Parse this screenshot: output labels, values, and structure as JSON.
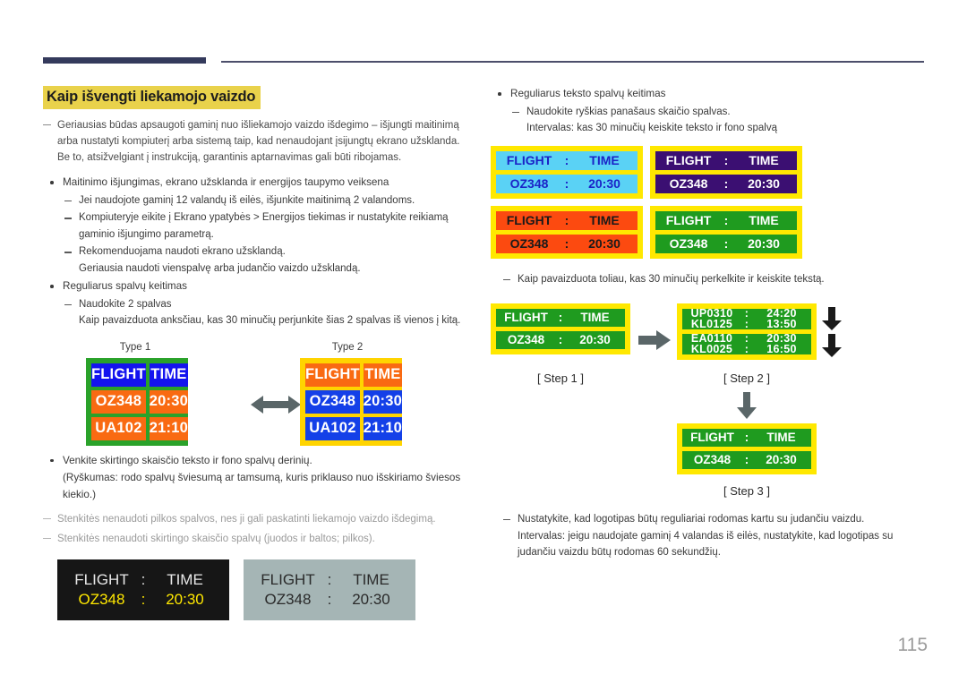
{
  "page": {
    "number": "115"
  },
  "left": {
    "title": "Kaip išvengti liekamojo vaizdo",
    "note_top": "Geriausias būdas apsaugoti gaminį nuo išliekamojo vaizdo išdegimo – išjungti maitinimą arba nustatyti kompiuterį arba sistemą taip, kad nenaudojant įsijungtų ekrano užsklanda. Be to, atsižvelgiant į instrukciją, garantinis aptarnavimas gali būti ribojamas.",
    "bullet1": "Maitinimo išjungimas, ekrano užsklanda ir energijos taupymo veiksena",
    "bullet1_items": [
      "Jei naudojote gaminį 12 valandų iš eilės, išjunkite maitinimą 2 valandoms.",
      "Kompiuteryje eikite į Ekrano ypatybės > Energijos tiekimas ir nustatykite reikiamą gaminio išjungimo parametrą.",
      "Rekomenduojama naudoti ekrano užsklandą."
    ],
    "bullet1_sub": "Geriausia naudoti vienspalvę arba judančio vaizdo užsklandą.",
    "bullet2": "Reguliarus spalvų keitimas",
    "bullet2_item": "Naudokite 2 spalvas",
    "bullet2_sub": "Kaip pavaizduota anksčiau, kas 30 minučių perjunkite šias 2 spalvas iš vienos į kitą.",
    "type1_label": "Type 1",
    "type2_label": "Type 2",
    "bullet3": "Venkite skirtingo skaisčio teksto ir fono spalvų derinių.",
    "bullet3_sub": "(Ryškumas: rodo spalvų šviesumą ar tamsumą, kuris priklauso nuo išskiriamo šviesos kiekio.)",
    "note_gray1": "Stenkitės nenaudoti pilkos spalvos, nes ji gali paskatinti liekamojo vaizdo išdegimą.",
    "note_gray2": "Stenkitės nenaudoti skirtingo skaisčio spalvų (juodos ir baltos; pilkos)."
  },
  "right": {
    "bullet1": "Reguliarus teksto spalvų keitimas",
    "bullet1_item": "Naudokite ryškias panašaus skaičio spalvas.",
    "bullet1_sub": "Intervalas: kas 30 minučių keiskite teksto ir fono spalvą",
    "steps_note": "Kaip pavaizduota toliau, kas 30 minučių perkelkite ir keiskite tekstą.",
    "step1_caption": "[ Step 1 ]",
    "step2_caption": "[ Step 2 ]",
    "step2_caption_b": "[ Step 2 ]",
    "step3_caption": "[ Step 3 ]",
    "final_item": "Nustatykite, kad logotipas būtų reguliariai rodomas kartu su judančiu vaizdu.",
    "final_sub": "Intervalas: jeigu naudojate gaminį 4 valandas iš eilės, nustatykite, kad logotipas su judančiu vaizdu būtų rodomas 60 sekundžių."
  },
  "board": {
    "header_flight": "FLIGHT",
    "header_time": "TIME",
    "separator": ":",
    "rows": [
      {
        "flight": "OZ348",
        "time": "20:30"
      },
      {
        "flight": "UA102",
        "time": "21:10"
      }
    ]
  },
  "type1": {
    "border_color": "#2aa22a",
    "header_bg": "#1414ef",
    "header_fg": "#ffffff",
    "cell_bg": "#f96a12",
    "cell_fg": "#ffffff"
  },
  "type2": {
    "border_color": "#ffd400",
    "header_bg": "#f96a12",
    "header_fg": "#ffffff",
    "cell_bg": "#1440e8",
    "cell_fg": "#ffffff"
  },
  "contrast_panels": [
    {
      "name": "black-panel",
      "bg": "#161616",
      "header_fg": "#e8e8e8",
      "value_fg": "#ffe800"
    },
    {
      "name": "gray-panel",
      "bg": "#a5b5b5",
      "header_fg": "#2a2a2a",
      "value_fg": "#2a2a2a"
    }
  ],
  "color_grid": [
    {
      "name": "cyan-panel",
      "border": "#ffe800",
      "bg": "#5ad2f5",
      "fg": "#1b23c8"
    },
    {
      "name": "purple-panel",
      "border": "#ffe800",
      "bg": "#3b0f72",
      "fg": "#ffffff"
    },
    {
      "name": "orange-panel",
      "border": "#ffe800",
      "bg": "#fc4a10",
      "fg": "#1a1a1a"
    },
    {
      "name": "green-panel",
      "border": "#ffe800",
      "bg": "#1f9b1f",
      "fg": "#ffffff"
    }
  ],
  "step2_lines": [
    {
      "flight": "UP0310",
      "time": "24:20"
    },
    {
      "flight": "KL0125",
      "time": "13:50"
    },
    {
      "flight": "EA0110",
      "time": "20:30"
    },
    {
      "flight": "KL0025",
      "time": "16:50"
    }
  ],
  "colors": {
    "accent_navy": "#343a5c",
    "highlight_yellow": "#e9d24b",
    "arrow_gray": "#5a6668"
  }
}
